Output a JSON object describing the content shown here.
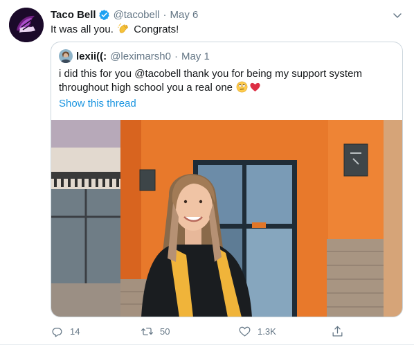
{
  "tweet": {
    "author_name": "Taco Bell",
    "author_handle": "@tacobell",
    "separator": "·",
    "date": "May 6",
    "text_part1": "It was all you.",
    "text_part2": "Congrats!",
    "emoji_1": "clapping-hands",
    "verified": true
  },
  "quoted_tweet": {
    "author_name": "lexii((:",
    "author_handle": "@leximarsh0",
    "separator": "·",
    "date": "May 1",
    "text": "i did this for you @tacobell thank you for being my support system throughout high school you a real one",
    "emojis": [
      "rolling-eyes-face",
      "red-heart"
    ],
    "show_thread_label": "Show this thread",
    "photo": "graduate-in-front-of-taco-bell"
  },
  "actions": {
    "reply_count": "14",
    "retweet_count": "50",
    "like_count": "1.3K"
  },
  "colors": {
    "link_blue": "#1b95e0",
    "verified_blue": "#1da1f2",
    "secondary_text": "#657786",
    "brand_purple": "#702082",
    "border": "#ccd6dd"
  }
}
